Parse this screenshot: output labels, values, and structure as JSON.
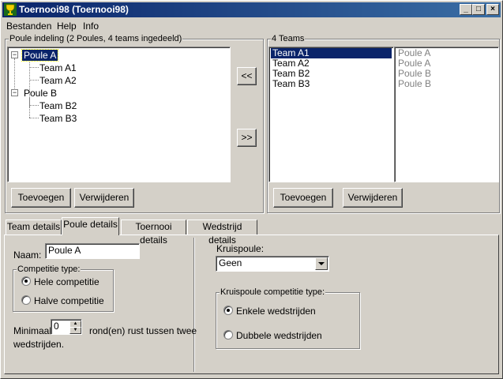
{
  "window": {
    "title": "Toernooi98 (Toernooi98)",
    "minimize": "_",
    "maximize": "□",
    "close": "×"
  },
  "menu": [
    "Bestanden",
    "Help",
    "Info"
  ],
  "poule_group": {
    "label": "Poule indeling (2 Poules, 4 teams ingedeeld)",
    "tree": [
      {
        "label": "Poule A",
        "children": [
          "Team A1",
          "Team A2"
        ]
      },
      {
        "label": "Poule B",
        "children": [
          "Team B2",
          "Team B3"
        ]
      }
    ],
    "add_button": "Toevoegen",
    "remove_button": "Verwijderen"
  },
  "transfer": {
    "left": "<<",
    "right": ">>"
  },
  "teams_group": {
    "label": "4 Teams",
    "teams": [
      "Team A1",
      "Team A2",
      "Team B2",
      "Team B3"
    ],
    "poules": [
      "Poule A",
      "Poule A",
      "Poule B",
      "Poule B"
    ],
    "add_button": "Toevoegen",
    "remove_button": "Verwijderen"
  },
  "tabs": [
    "Team details",
    "Poule details",
    "Toernooi details",
    "Wedstrijd details"
  ],
  "poule_details": {
    "name_label": "Naam:",
    "name_value": "Poule A",
    "competition_type_label": "Competitie type:",
    "competition_options": [
      "Hele competitie",
      "Halve competitie"
    ],
    "competition_selected": 0,
    "minimum_label": "Minimaal",
    "minimum_value": "0",
    "rest_text_1": "rond(en) rust tussen twee",
    "rest_text_2": "wedstrijden.",
    "cross_poule_label": "Kruispoule:",
    "cross_poule_value": "Geen",
    "cross_type_label": "Kruispoule competitie type:",
    "cross_type_options": [
      "Enkele wedstrijden",
      "Dubbele wedstrijden"
    ],
    "cross_type_selected": 0
  }
}
